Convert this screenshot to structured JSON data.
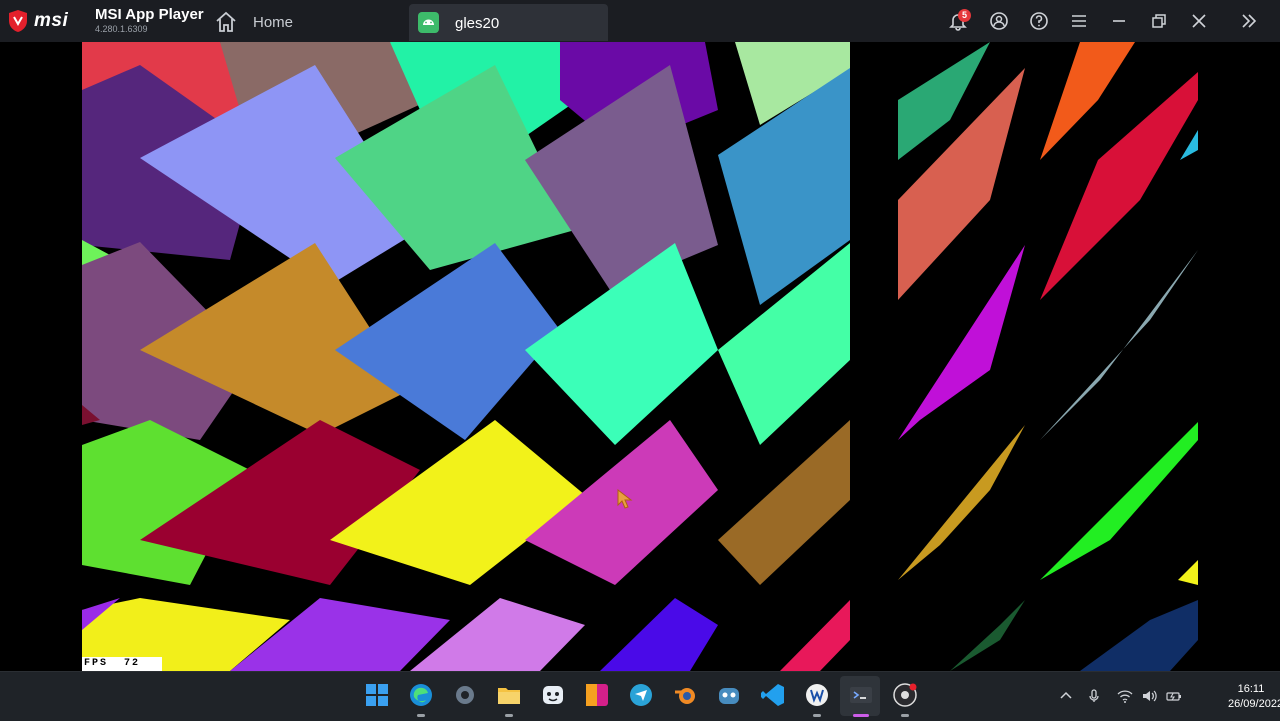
{
  "titlebar": {
    "brand": "msi",
    "app_name": "MSI App Player",
    "version": "4.280.1.6309",
    "home_label": "Home",
    "tab_label": "gles20",
    "notification_count": "5",
    "icons": [
      "bell-icon",
      "account-icon",
      "help-icon",
      "menu-icon",
      "minimize-icon",
      "restore-icon",
      "close-icon",
      "expand-sidebar-icon"
    ]
  },
  "game": {
    "fps_label": "FPS  72"
  },
  "taskbar": {
    "apps": [
      "windows-start",
      "edge",
      "settings",
      "file-explorer",
      "app-mascot",
      "photoshop",
      "chat-app",
      "blender",
      "godot",
      "vscode",
      "word",
      "terminal",
      "obs-studio"
    ],
    "time": "16:11",
    "date": "26/09/2022"
  }
}
